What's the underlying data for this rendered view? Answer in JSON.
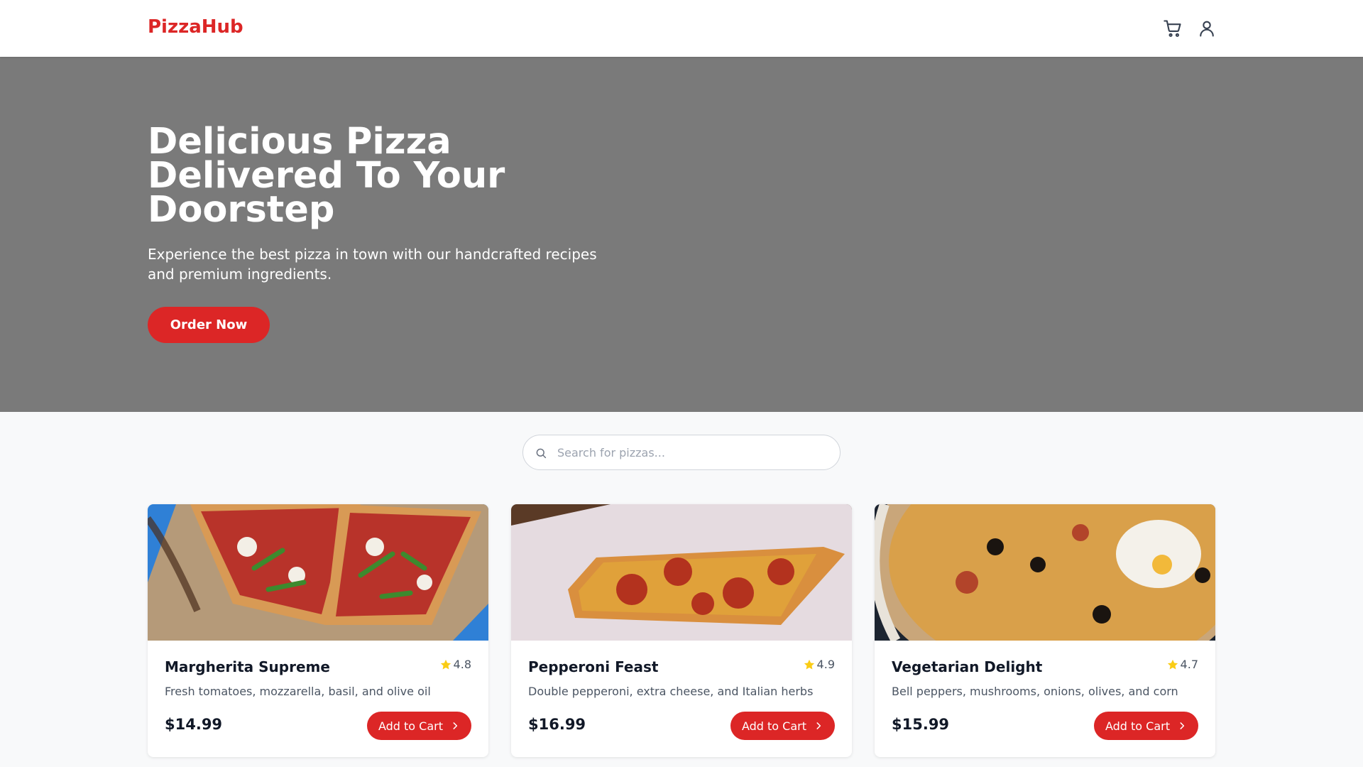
{
  "brand": {
    "name": "PizzaHub",
    "accent": "#dc2626"
  },
  "nav": {
    "icons": [
      "cart-icon",
      "user-icon"
    ]
  },
  "hero": {
    "title": "Delicious Pizza Delivered To Your Doorstep",
    "subtitle": "Experience the best pizza in town with our handcrafted recipes and premium ingredients.",
    "cta": "Order Now"
  },
  "search": {
    "placeholder": "Search for pizzas..."
  },
  "pizzas": [
    {
      "name": "Margherita Supreme",
      "rating": "4.8",
      "description": "Fresh tomatoes, mozzarella, basil, and olive oil",
      "price": "$14.99",
      "button": "Add to Cart"
    },
    {
      "name": "Pepperoni Feast",
      "rating": "4.9",
      "description": "Double pepperoni, extra cheese, and Italian herbs",
      "price": "$16.99",
      "button": "Add to Cart"
    },
    {
      "name": "Vegetarian Delight",
      "rating": "4.7",
      "description": "Bell peppers, mushrooms, onions, olives, and corn",
      "price": "$15.99",
      "button": "Add to Cart"
    }
  ]
}
